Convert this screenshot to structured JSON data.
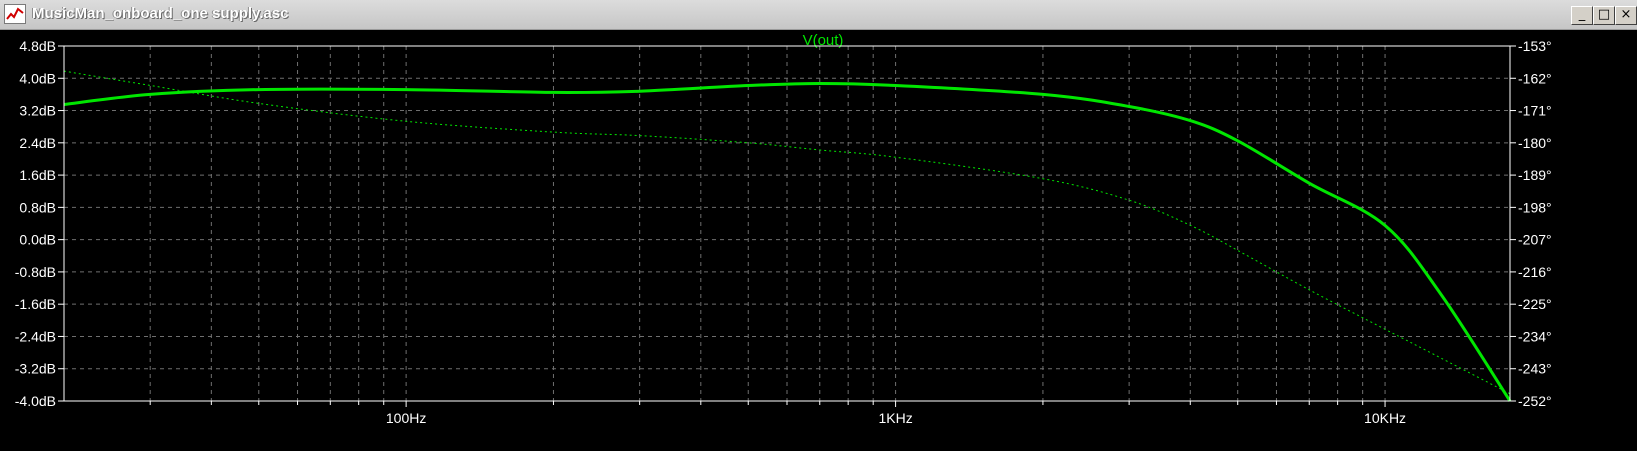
{
  "window": {
    "title": "MusicMan_onboard_one supply.asc",
    "buttons": {
      "minimize": "_",
      "restore": "□",
      "close": "×"
    }
  },
  "colors": {
    "background": "#000000",
    "trace": "#00e600",
    "grid": "#6f6f6f",
    "text": "#ffffff"
  },
  "chart_data": {
    "type": "line",
    "title": "V(out)",
    "x_scale": "log",
    "xlim": [
      20,
      18000
    ],
    "x_ticks": [
      {
        "value": 100,
        "label": "100Hz"
      },
      {
        "value": 1000,
        "label": "1KHz"
      },
      {
        "value": 10000,
        "label": "10KHz"
      }
    ],
    "y_left": {
      "unit": "dB",
      "ylim": [
        -4.0,
        4.8
      ],
      "ticks": [
        "4.8dB",
        "4.0dB",
        "3.2dB",
        "2.4dB",
        "1.6dB",
        "0.8dB",
        "0.0dB",
        "-0.8dB",
        "-1.6dB",
        "-2.4dB",
        "-3.2dB",
        "-4.0dB"
      ]
    },
    "y_right": {
      "unit": "°",
      "ylim": [
        -252,
        -153
      ],
      "ticks": [
        "-153°",
        "-162°",
        "-171°",
        "-180°",
        "-189°",
        "-198°",
        "-207°",
        "-216°",
        "-225°",
        "-234°",
        "-243°",
        "-252°"
      ]
    },
    "grid": true,
    "series": [
      {
        "name": "V(out)",
        "axis": "left",
        "style": "solid",
        "x": [
          20,
          30,
          50,
          100,
          200,
          300,
          500,
          700,
          1000,
          2000,
          3000,
          4000,
          5000,
          7000,
          10000,
          13000,
          18000
        ],
        "y": [
          3.35,
          3.6,
          3.72,
          3.72,
          3.65,
          3.68,
          3.82,
          3.87,
          3.82,
          3.6,
          3.3,
          2.95,
          2.45,
          1.4,
          0.35,
          -1.35,
          -4.0
        ]
      },
      {
        "axis": "right",
        "style": "dotted",
        "x": [
          20,
          30,
          50,
          100,
          200,
          300,
          500,
          700,
          1000,
          2000,
          3000,
          4000,
          5000,
          7000,
          10000,
          13000,
          18000
        ],
        "y": [
          -160,
          -164,
          -169,
          -174,
          -177,
          -178,
          -180,
          -182,
          -184,
          -190,
          -196,
          -203,
          -210,
          -221,
          -232,
          -240,
          -250
        ]
      }
    ]
  }
}
